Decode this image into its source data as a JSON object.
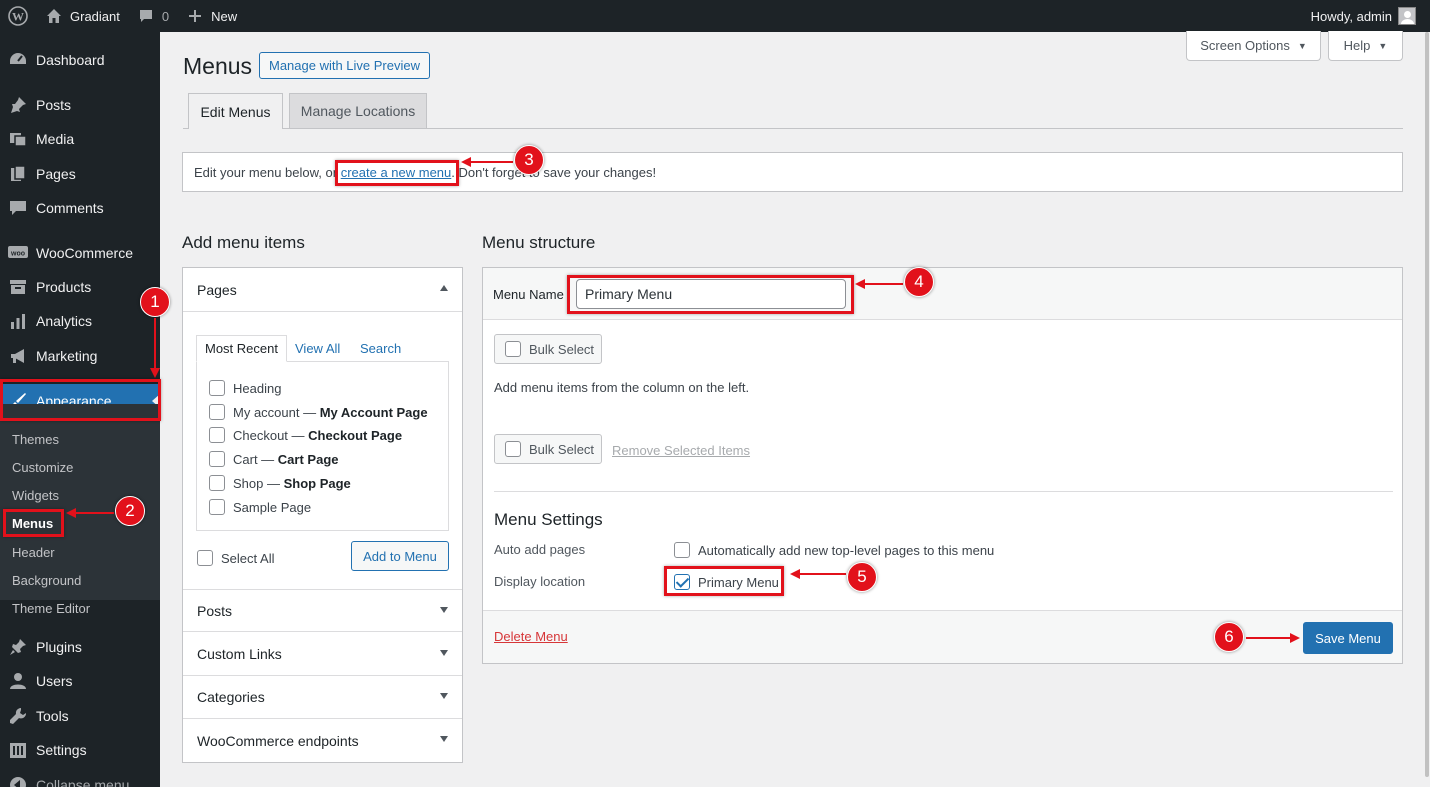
{
  "adminbar": {
    "site_name": "Gradiant",
    "comments_count": "0",
    "new_label": "New",
    "howdy": "Howdy, admin"
  },
  "sidebar": {
    "items": [
      {
        "label": "Dashboard",
        "icon": "dashboard-icon"
      },
      {
        "label": "Posts",
        "icon": "pin-icon"
      },
      {
        "label": "Media",
        "icon": "media-icon"
      },
      {
        "label": "Pages",
        "icon": "pages-icon"
      },
      {
        "label": "Comments",
        "icon": "comment-icon"
      },
      {
        "label": "WooCommerce",
        "icon": "woo-icon"
      },
      {
        "label": "Products",
        "icon": "archive-icon"
      },
      {
        "label": "Analytics",
        "icon": "chart-icon"
      },
      {
        "label": "Marketing",
        "icon": "megaphone-icon"
      },
      {
        "label": "Appearance",
        "icon": "brush-icon"
      },
      {
        "label": "Plugins",
        "icon": "plugin-icon"
      },
      {
        "label": "Users",
        "icon": "users-icon"
      },
      {
        "label": "Tools",
        "icon": "wrench-icon"
      },
      {
        "label": "Settings",
        "icon": "settings-icon"
      },
      {
        "label": "Collapse menu",
        "icon": "collapse-icon"
      }
    ],
    "submenu": [
      "Themes",
      "Customize",
      "Widgets",
      "Menus",
      "Header",
      "Background",
      "Theme Editor"
    ]
  },
  "header": {
    "title": "Menus",
    "live_preview": "Manage with Live Preview",
    "screen_options": "Screen Options",
    "help": "Help"
  },
  "tabs": [
    "Edit Menus",
    "Manage Locations"
  ],
  "notice": {
    "before": "Edit your menu below, or ",
    "link": "create a new menu",
    "after": ". Don't forget to save your changes!"
  },
  "add_items": {
    "title": "Add menu items",
    "pages_header": "Pages",
    "inner_tabs": [
      "Most Recent",
      "View All",
      "Search"
    ],
    "pages": [
      {
        "name": "Heading",
        "suffix": ""
      },
      {
        "name": "My account — ",
        "suffix": "My Account Page"
      },
      {
        "name": "Checkout — ",
        "suffix": "Checkout Page"
      },
      {
        "name": "Cart — ",
        "suffix": "Cart Page"
      },
      {
        "name": "Shop — ",
        "suffix": "Shop Page"
      },
      {
        "name": "Sample Page",
        "suffix": ""
      }
    ],
    "select_all": "Select All",
    "add_to_menu": "Add to Menu",
    "sections": [
      "Posts",
      "Custom Links",
      "Categories",
      "WooCommerce endpoints"
    ]
  },
  "structure": {
    "title": "Menu structure",
    "menu_name_label": "Menu Name",
    "menu_name_value": "Primary Menu",
    "bulk_select": "Bulk Select",
    "empty_hint": "Add menu items from the column on the left.",
    "remove_selected": "Remove Selected Items",
    "settings_title": "Menu Settings",
    "auto_add_label": "Auto add pages",
    "auto_add_text": "Automatically add new top-level pages to this menu",
    "display_location_label": "Display location",
    "location_option": "Primary Menu",
    "location_checked": true,
    "delete_menu": "Delete Menu",
    "save_menu": "Save Menu"
  },
  "annotations": [
    "1",
    "2",
    "3",
    "4",
    "5",
    "6"
  ],
  "colors": {
    "accent": "#2271b1",
    "annotation": "#e2111b",
    "sidebar_bg": "#1d2327"
  }
}
